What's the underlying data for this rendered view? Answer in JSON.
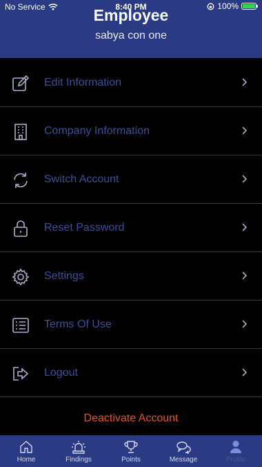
{
  "status_bar": {
    "carrier": "No Service",
    "time": "8:40 PM",
    "battery": "100%"
  },
  "header": {
    "title": "Employee",
    "subtitle": "sabya con one"
  },
  "menu": [
    {
      "label": "Edit Information",
      "icon": "edit-icon"
    },
    {
      "label": "Company Information",
      "icon": "building-icon"
    },
    {
      "label": "Switch Account",
      "icon": "switch-icon"
    },
    {
      "label": "Reset Password",
      "icon": "lock-icon"
    },
    {
      "label": "Settings",
      "icon": "gear-icon"
    },
    {
      "label": "Terms Of Use",
      "icon": "list-icon"
    },
    {
      "label": "Logout",
      "icon": "logout-icon"
    }
  ],
  "deactivate_label": "Deactivate Account",
  "tabs": [
    {
      "label": "Home",
      "icon": "home-icon"
    },
    {
      "label": "Findings",
      "icon": "siren-icon"
    },
    {
      "label": "Points",
      "icon": "trophy-icon"
    },
    {
      "label": "Message",
      "icon": "chat-icon"
    },
    {
      "label": "Profile",
      "icon": "user-icon",
      "active": true
    }
  ],
  "colors": {
    "header_bg": "#2b3b83",
    "menu_text": "#3a4f98",
    "danger": "#e4531f",
    "background": "#000000"
  }
}
